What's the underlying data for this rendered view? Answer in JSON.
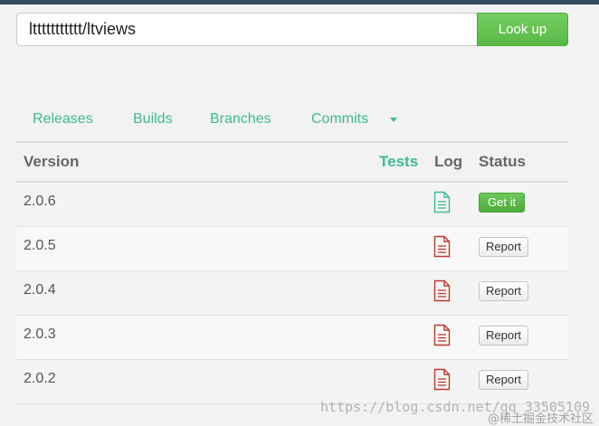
{
  "search": {
    "value": "lttttttttttt/ltviews",
    "button_label": "Look up"
  },
  "tabs": [
    {
      "label": "Releases"
    },
    {
      "label": "Builds"
    },
    {
      "label": "Branches"
    },
    {
      "label": "Commits"
    }
  ],
  "table": {
    "headers": {
      "version": "Version",
      "tests": "Tests",
      "log": "Log",
      "status": "Status"
    },
    "rows": [
      {
        "version": "2.0.6",
        "log_icon": "document-icon-green",
        "status": "Get it"
      },
      {
        "version": "2.0.5",
        "log_icon": "document-icon-red",
        "status": "Report"
      },
      {
        "version": "2.0.4",
        "log_icon": "document-icon-red",
        "status": "Report"
      },
      {
        "version": "2.0.3",
        "log_icon": "document-icon-red",
        "status": "Report"
      },
      {
        "version": "2.0.2",
        "log_icon": "document-icon-red",
        "status": "Report"
      }
    ]
  },
  "watermark": {
    "url": "https://blog.csdn.net/qq_33505109",
    "label": "@稀土掘金技术社区"
  },
  "colors": {
    "accent": "#3dbb8f",
    "button_green": "#5cbd48",
    "log_ok": "#3dbb8f",
    "log_fail": "#c0392b",
    "topbar": "#34495e"
  }
}
